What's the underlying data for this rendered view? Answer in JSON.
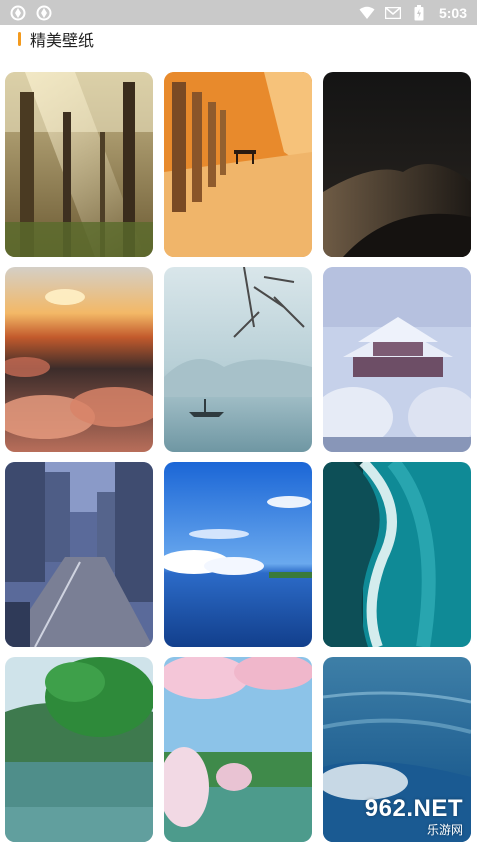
{
  "status_bar": {
    "time": "5:03",
    "left_icons": [
      "app-notification-icon",
      "app-notification-icon"
    ],
    "right_icons": [
      "wifi-icon",
      "mail-icon",
      "battery-icon"
    ]
  },
  "section": {
    "title": "精美壁纸",
    "accent_color": "#f39a1e"
  },
  "wallpapers": [
    {
      "subject": "forest-sunrays"
    },
    {
      "subject": "autumn-avenue-bench"
    },
    {
      "subject": "dark-dunes"
    },
    {
      "subject": "sunset-clouds"
    },
    {
      "subject": "misty-lake-boat"
    },
    {
      "subject": "snowy-temple"
    },
    {
      "subject": "anime-street"
    },
    {
      "subject": "blue-sea-sky"
    },
    {
      "subject": "aerial-wave"
    },
    {
      "subject": "green-lake-tree"
    },
    {
      "subject": "cherry-blossom-lake"
    },
    {
      "subject": "ocean-surf"
    }
  ],
  "watermark": {
    "main": "962.NET",
    "sub": "乐游网"
  }
}
